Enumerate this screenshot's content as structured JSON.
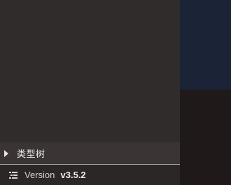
{
  "sidebar": {
    "tree_item": {
      "label": "类型树",
      "icon": "caret-right-icon"
    },
    "footer": {
      "icon": "list-icon",
      "version_label": "Version",
      "version_number": "v3.5.2"
    }
  },
  "colors": {
    "sidebar_bg": "#302c2b",
    "tree_row_bg": "#3a3534",
    "footer_bg": "#2b2726",
    "right_top_bg": "#1a2436",
    "right_bottom_bg": "#1f1a19"
  }
}
